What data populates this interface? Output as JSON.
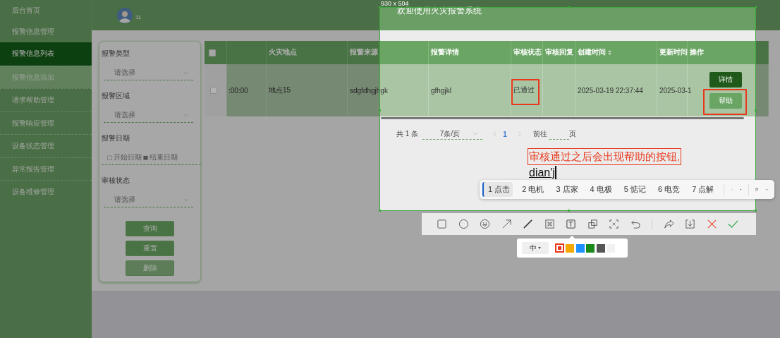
{
  "sidebar": {
    "items": [
      {
        "label": "后台首页",
        "selected": false,
        "hovered": false
      },
      {
        "label": "报警信息管理",
        "selected": false,
        "hovered": false
      },
      {
        "label": "报警信息列表",
        "selected": true,
        "hovered": false
      },
      {
        "label": "报警信息添加",
        "selected": false,
        "hovered": true
      },
      {
        "label": "请求帮助管理",
        "selected": false,
        "hovered": false
      },
      {
        "label": "报警响应管理",
        "selected": false,
        "hovered": false
      },
      {
        "label": "设备状态管理",
        "selected": false,
        "hovered": false
      },
      {
        "label": "异常报告管理",
        "selected": false,
        "hovered": false
      },
      {
        "label": "设备维修管理",
        "selected": false,
        "hovered": false
      }
    ]
  },
  "header": {
    "user": "11",
    "title": "欢迎使用火灾报警系统"
  },
  "filters": [
    {
      "kind": "select",
      "label": "报警类型",
      "placeholder": "请选择"
    },
    {
      "kind": "select",
      "label": "报警区域",
      "placeholder": "请选择"
    },
    {
      "kind": "daterange",
      "label": "报警日期",
      "start_placeholder": "开始日期",
      "end_placeholder": "结束日期"
    },
    {
      "kind": "select",
      "label": "审核状态",
      "placeholder": "请选择"
    }
  ],
  "filter_buttons": [
    {
      "label": "查询",
      "disabled": false
    },
    {
      "label": "重置",
      "disabled": false
    },
    {
      "label": "删除",
      "disabled": true
    }
  ],
  "table": {
    "all_checked": false,
    "columns": [
      {
        "kind": "checkbox"
      },
      {
        "kind": "text"
      },
      {
        "label": "火灾地点",
        "kind": "text"
      },
      {
        "label": "报警来源",
        "kind": "text"
      },
      {
        "label": "报警详情",
        "kind": "text"
      },
      {
        "label": "审核状态",
        "kind": "text"
      },
      {
        "label": "审核回复",
        "kind": "text"
      },
      {
        "label": "创建时间",
        "kind": "text",
        "sortable": true
      },
      {
        "label": "更新时间",
        "kind": "text"
      },
      {
        "label": "操作",
        "kind": "actions"
      }
    ],
    "rows": [
      {
        "checked": false,
        "cells": [
          null,
          ":00:00",
          "地点15",
          "sdgfdhgjhgk",
          "gfhgjkl",
          "已通过",
          null,
          "2025-03-19 22:37:44",
          "2025-03-1",
          null
        ],
        "actions": [
          {
            "label": "详情",
            "kind": "primary"
          },
          {
            "label": "帮助",
            "kind": "light"
          }
        ]
      }
    ]
  },
  "pagination": {
    "total": "共 1 条",
    "page_size": "7条/页",
    "pages": [
      {
        "label": "1",
        "selected": true
      }
    ],
    "goto_label": "前往",
    "goto_suffix": "页"
  },
  "capture": {
    "size": "930 x 504",
    "annotation": "审核通过之后会出现帮助的按钮,",
    "composition": "dian'j",
    "candidates": [
      {
        "label": "1 点击",
        "selected": true
      },
      {
        "label": "2 电机",
        "selected": false
      },
      {
        "label": "3 店家",
        "selected": false
      },
      {
        "label": "4 电极",
        "selected": false
      },
      {
        "label": "5 惦记",
        "selected": false
      },
      {
        "label": "6 电竞",
        "selected": false
      },
      {
        "label": "7 点解",
        "selected": false
      }
    ],
    "text_size": "中",
    "colors": [
      {
        "color": "#e8391d",
        "selected": true
      },
      {
        "color": "#f5a800",
        "selected": false
      },
      {
        "color": "#1e90ff",
        "selected": false
      },
      {
        "color": "#1a8a1a",
        "selected": false
      },
      {
        "color": "#555555",
        "selected": false
      },
      {
        "color": "#f2f2f2",
        "selected": false
      }
    ]
  }
}
